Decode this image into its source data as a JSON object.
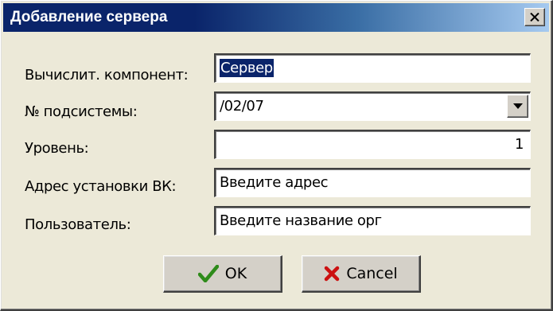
{
  "window": {
    "title": "Добавление сервера",
    "colors": {
      "titlebar_start": "#0a246a",
      "titlebar_end": "#a6caf0",
      "face": "#ece9d8"
    }
  },
  "form": {
    "component": {
      "label": "Вычислит. компонент:",
      "value": "Сервер"
    },
    "subsystem": {
      "label": "№ подсистемы:",
      "value": "/02/07"
    },
    "level": {
      "label": "Уровень:",
      "value": "1"
    },
    "address": {
      "label": "Адрес установки ВК:",
      "value": "Введите адрес"
    },
    "user": {
      "label": "Пользователь:",
      "value": "Введите название орг"
    }
  },
  "buttons": {
    "ok": {
      "label": "OK",
      "icon": "checkmark-icon",
      "color": "#2e8b1a"
    },
    "cancel": {
      "label": "Cancel",
      "icon": "x-mark-icon",
      "color": "#cc1111"
    }
  },
  "icons": {
    "close": "close-icon",
    "dropdown": "chevron-down-icon"
  }
}
